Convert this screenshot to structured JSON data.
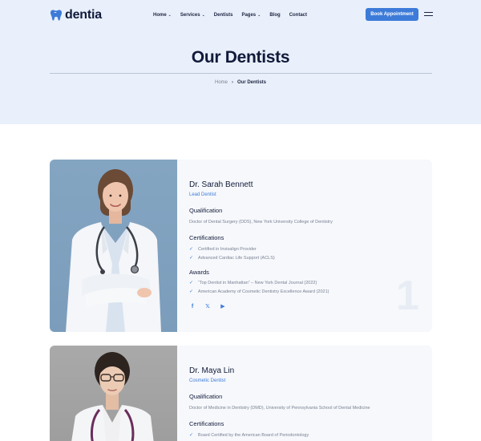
{
  "brand": {
    "name": "dentia",
    "accent": "#3d7bd9"
  },
  "nav": {
    "items": [
      {
        "label": "Home",
        "has_dropdown": true
      },
      {
        "label": "Services",
        "has_dropdown": true
      },
      {
        "label": "Dentists",
        "has_dropdown": false
      },
      {
        "label": "Pages",
        "has_dropdown": true
      },
      {
        "label": "Blog",
        "has_dropdown": false
      },
      {
        "label": "Contact",
        "has_dropdown": false
      }
    ],
    "cta_label": "Book Appointment",
    "menu_icon": "hamburger-icon"
  },
  "hero": {
    "title": "Our Dentists",
    "breadcrumb": {
      "home": "Home",
      "separator": "›",
      "current": "Our Dentists"
    }
  },
  "dentists": [
    {
      "name": "Dr. Sarah Bennett",
      "role": "Lead Dentist",
      "qualification_title": "Qualification",
      "qualification": "Doctor of Dental Surgery (DDS), New York University College of Dentistry",
      "certifications_title": "Certifications",
      "certifications": [
        "Certified in Invisalign Provider",
        "Advanced Cardiac Life Support (ACLS)"
      ],
      "awards_title": "Awards",
      "awards": [
        "“Top Dentist in Manhattan” – New York Dental Journal (2022)",
        "American Academy of Cosmetic Dentistry Excellence Award (2021)"
      ],
      "socials": [
        "f",
        "𝕏",
        "▶"
      ],
      "number": "1"
    },
    {
      "name": "Dr. Maya Lin",
      "role": "Cosmetic Dentist",
      "qualification_title": "Qualification",
      "qualification": "Doctor of Medicine in Dentistry (DMD), University of Pennsylvania School of Dental Medicine",
      "certifications_title": "Certifications",
      "certifications": [
        "Board Certified by the American Board of Periodontology"
      ]
    }
  ]
}
